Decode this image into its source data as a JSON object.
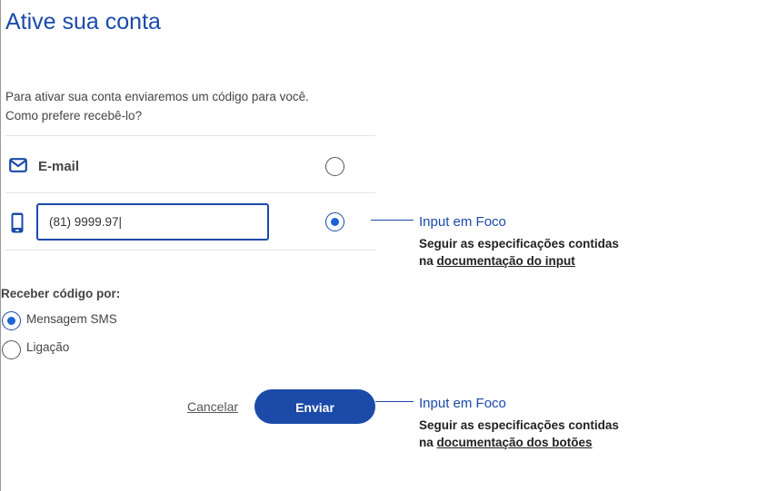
{
  "page": {
    "title": "Ative sua conta"
  },
  "intro": {
    "line1": "Para ativar sua conta enviaremos um código para você.",
    "line2": "Como prefere recebê-lo?"
  },
  "methods": {
    "email": {
      "label": "E-mail",
      "icon": "envelope-icon",
      "selected": false
    },
    "phone": {
      "icon": "mobile-phone-icon",
      "value": "(81) 9999.97|",
      "selected": true
    }
  },
  "receive": {
    "label": "Receber código por:",
    "options": [
      {
        "label": "Mensagem SMS",
        "selected": true
      },
      {
        "label": "Ligação",
        "selected": false
      }
    ]
  },
  "actions": {
    "cancel_label": "Cancelar",
    "send_label": "Enviar"
  },
  "annotations": [
    {
      "title": "Input em Foco",
      "text_prefix": "Seguir as especificações contidas",
      "text_line2_prefix": "na ",
      "link": "documentação do input"
    },
    {
      "title": "Input em Foco",
      "text_prefix": "Seguir as especificações contidas",
      "text_line2_prefix": "na ",
      "link": "documentação dos botões"
    }
  ],
  "colors": {
    "primary": "#1b4aa8",
    "radio_fill": "#1d63d6",
    "divider": "#e3e3e3"
  }
}
